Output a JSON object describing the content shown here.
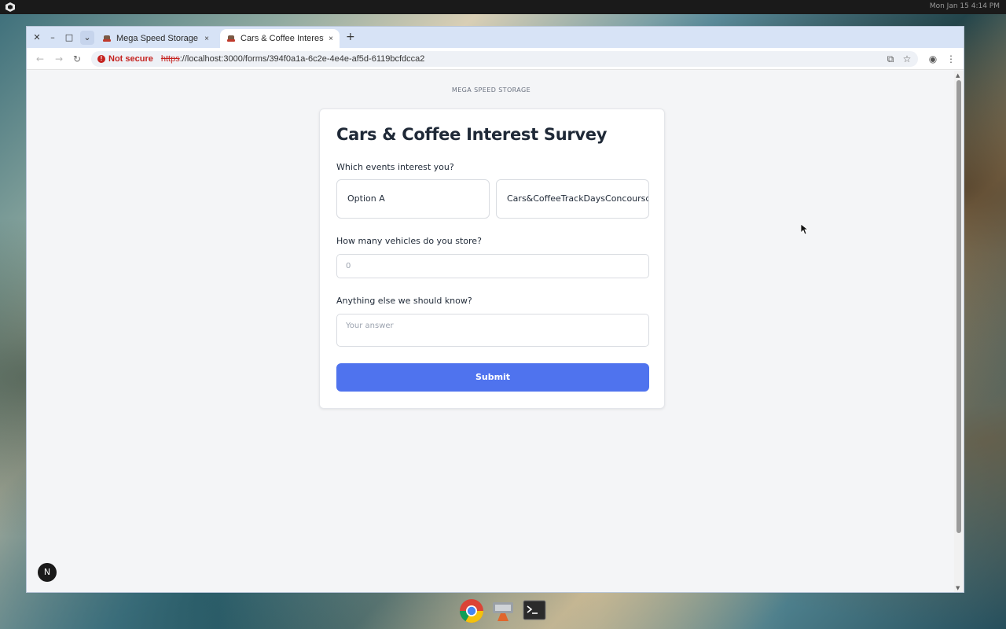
{
  "top_panel": {
    "clock": "Mon Jan 15 4:14 PM"
  },
  "browser": {
    "tabs": [
      {
        "title": "Mega Speed Storage",
        "close": "×"
      },
      {
        "title": "Cars & Coffee Interest S",
        "close": "×"
      }
    ],
    "new_tab": "+",
    "window_controls": {
      "close": "✕",
      "minimize": "–",
      "maximize": "□",
      "tab_menu": "⌄"
    },
    "omnibox": {
      "security_label": "Not secure",
      "url_scheme": "https",
      "url_rest": "://localhost:3000/forms/394f0a1a-6c2e-4e4e-af5d-6119bcfdcca2"
    }
  },
  "page": {
    "brand": "MEGA SPEED STORAGE",
    "form": {
      "title": "Cars & Coffee Interest Survey",
      "q1": {
        "label": "Which events interest you?",
        "options": [
          "Option A",
          "Cars&CoffeeTrackDaysConcoursd'Elegance"
        ]
      },
      "q2": {
        "label": "How many vehicles do you store?",
        "placeholder": "0"
      },
      "q3": {
        "label": "Anything else we should know?",
        "placeholder": "Your answer"
      },
      "submit_label": "Submit"
    },
    "dev_badge": "N"
  },
  "colors": {
    "accent": "#4f73ee",
    "not_secure": "#c5221f",
    "tab_strip": "#d7e3f6"
  },
  "icons": [
    "back-icon",
    "forward-icon",
    "reload-icon",
    "install-app-icon",
    "bookmark-star-icon",
    "profile-icon",
    "menu-icon",
    "chrome-icon",
    "app-icon",
    "terminal-icon"
  ]
}
